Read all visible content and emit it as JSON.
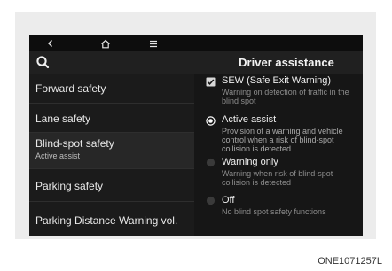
{
  "topbar": {
    "back_icon": "chevron-left-icon",
    "home_icon": "home-icon",
    "menu_icon": "menu-icon"
  },
  "header": {
    "search_icon": "search-icon",
    "title": "Driver assistance"
  },
  "left_menu": [
    {
      "label": "Forward safety",
      "sub": ""
    },
    {
      "label": "Lane safety",
      "sub": ""
    },
    {
      "label": "Blind-spot safety",
      "sub": "Active assist"
    },
    {
      "label": "Parking safety",
      "sub": ""
    },
    {
      "label": "Parking Distance Warning vol.",
      "sub": ""
    }
  ],
  "options": [
    {
      "type": "checkbox",
      "checked": true,
      "label": "SEW (Safe Exit Warning)",
      "desc": "Warning on detection of traffic in the blind spot"
    },
    {
      "type": "radio",
      "checked": true,
      "label": "Active assist",
      "desc": "Provision of a warning and vehicle control when a risk of blind-spot collision is detected"
    },
    {
      "type": "radio",
      "checked": false,
      "label": "Warning only",
      "desc": "Warning when risk of blind-spot collision is detected"
    },
    {
      "type": "radio",
      "checked": false,
      "label": "Off",
      "desc": "No blind spot safety functions"
    }
  ],
  "caption": "ONE1071257L"
}
